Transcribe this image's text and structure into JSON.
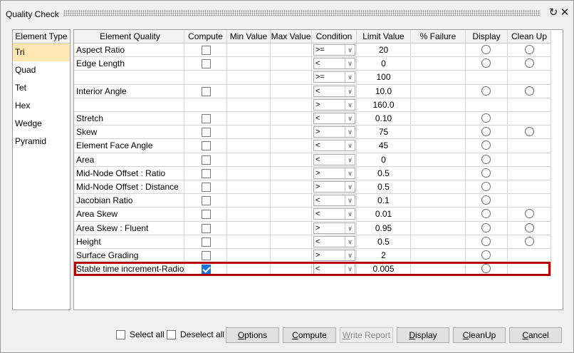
{
  "window": {
    "title": "Quality Check",
    "icons": [
      "refresh-icon",
      "close-icon"
    ]
  },
  "element_types": {
    "header": "Element Type",
    "items": [
      "Tri",
      "Quad",
      "Tet",
      "Hex",
      "Wedge",
      "Pyramid"
    ],
    "selected": "Tri"
  },
  "table": {
    "columns": [
      "Element Quality",
      "Compute",
      "Min Value",
      "Max Value",
      "Condition",
      "Limit Value",
      "% Failure",
      "Display",
      "Clean Up"
    ],
    "rows": [
      {
        "name": "Aspect Ratio",
        "compute": false,
        "condition": ">=",
        "limit": "20",
        "display": true,
        "cleanup": true
      },
      {
        "name": "Edge Length",
        "compute": false,
        "condition": "<",
        "limit": "0",
        "display": true,
        "cleanup": true
      },
      {
        "name": "",
        "compute": null,
        "condition": ">=",
        "limit": "100",
        "display": false,
        "cleanup": false
      },
      {
        "name": "Interior Angle",
        "compute": false,
        "condition": "<",
        "limit": "10.0",
        "display": true,
        "cleanup": true
      },
      {
        "name": "",
        "compute": null,
        "condition": ">",
        "limit": "160.0",
        "display": false,
        "cleanup": false
      },
      {
        "name": "Stretch",
        "compute": false,
        "condition": "<",
        "limit": "0.10",
        "display": true,
        "cleanup": false
      },
      {
        "name": "Skew",
        "compute": false,
        "condition": ">",
        "limit": "75",
        "display": true,
        "cleanup": true
      },
      {
        "name": "Element Face Angle",
        "compute": false,
        "condition": "<",
        "limit": "45",
        "display": true,
        "cleanup": false
      },
      {
        "name": "Area",
        "compute": false,
        "condition": "<",
        "limit": "0",
        "display": true,
        "cleanup": false
      },
      {
        "name": "Mid-Node Offset : Ratio",
        "compute": false,
        "condition": ">",
        "limit": "0.5",
        "display": true,
        "cleanup": false
      },
      {
        "name": "Mid-Node Offset : Distance",
        "compute": false,
        "condition": ">",
        "limit": "0.5",
        "display": true,
        "cleanup": false
      },
      {
        "name": "Jacobian Ratio",
        "compute": false,
        "condition": "<",
        "limit": "0.1",
        "display": true,
        "cleanup": false
      },
      {
        "name": "Area Skew",
        "compute": false,
        "condition": "<",
        "limit": "0.01",
        "display": true,
        "cleanup": true
      },
      {
        "name": "Area Skew : Fluent",
        "compute": false,
        "condition": ">",
        "limit": "0.95",
        "display": true,
        "cleanup": true
      },
      {
        "name": "Height",
        "compute": false,
        "condition": "<",
        "limit": "0.5",
        "display": true,
        "cleanup": true
      },
      {
        "name": "Surface Grading",
        "compute": false,
        "condition": ">",
        "limit": "2",
        "display": true,
        "cleanup": false
      },
      {
        "name": "Stable time increment-Radioss",
        "compute": true,
        "condition": "<",
        "limit": "0.005",
        "display": true,
        "cleanup": false
      }
    ]
  },
  "footer": {
    "select_all": "Select all",
    "deselect_all": "Deselect all",
    "buttons": [
      {
        "u": "O",
        "rest": "ptions",
        "name": "options-button",
        "enabled": true
      },
      {
        "u": "C",
        "rest": "ompute",
        "name": "compute-button",
        "enabled": true
      },
      {
        "u": "W",
        "rest": "rite Report",
        "name": "write-report-button",
        "enabled": false
      },
      {
        "u": "D",
        "rest": "isplay",
        "name": "display-button",
        "enabled": true
      },
      {
        "u": "C",
        "rest": "leanUp",
        "name": "cleanup-button",
        "enabled": true
      },
      {
        "u": "C",
        "rest": "ancel",
        "name": "cancel-button",
        "enabled": true
      }
    ]
  },
  "colors": {
    "selection": "#fde6b2",
    "highlight_border": "#b30000",
    "checkbox_on": "#1a73d6"
  }
}
